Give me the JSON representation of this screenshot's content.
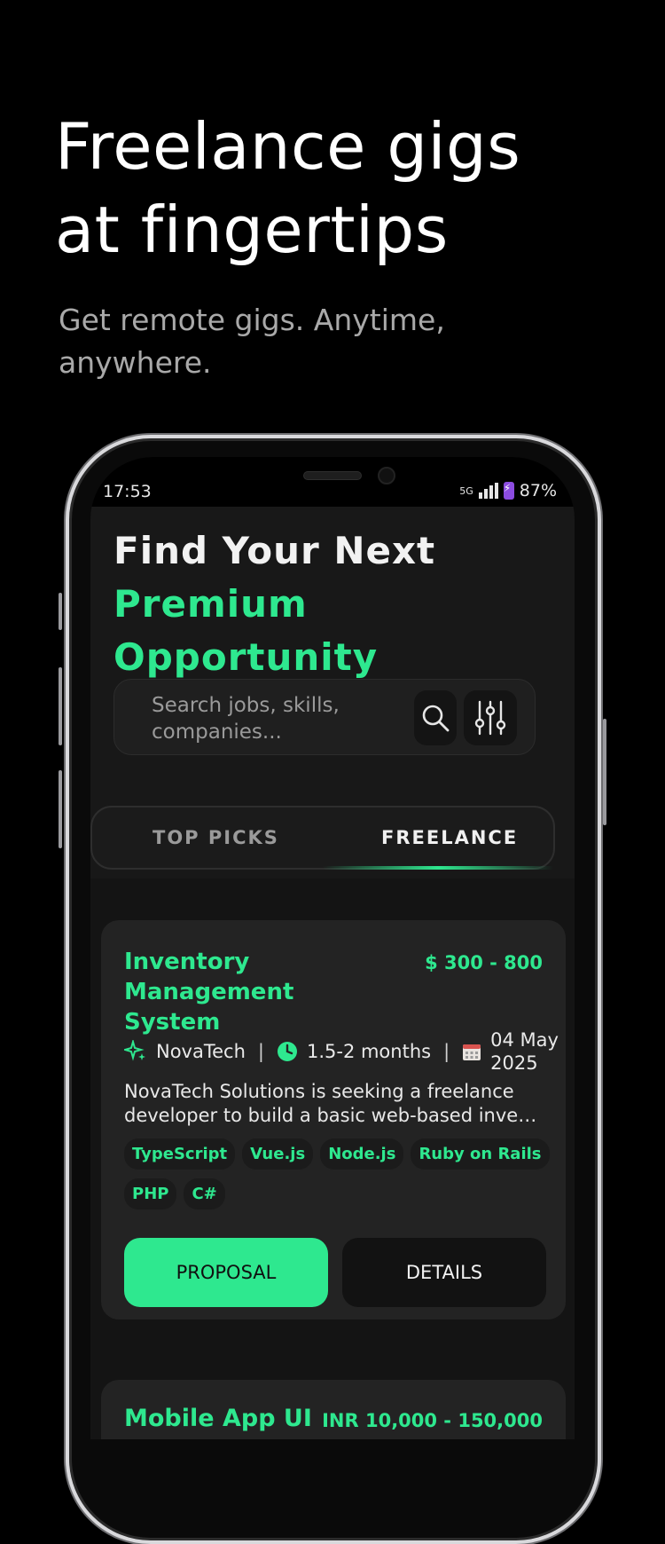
{
  "hero": {
    "title_line1": "Freelance gigs",
    "title_line2": "at fingertips",
    "subtitle_line1": "Get remote gigs. Anytime,",
    "subtitle_line2": "anywhere."
  },
  "status_bar": {
    "time": "17:53",
    "network": "5G",
    "battery": "87%"
  },
  "screen": {
    "heading_line1": "Find Your Next",
    "heading_line2": "Premium Opportunity",
    "search": {
      "placeholder_line1": "Search jobs, skills,",
      "placeholder_line2": "companies..."
    },
    "tabs": [
      {
        "label": "TOP PICKS",
        "active": false
      },
      {
        "label": "FREELANCE",
        "active": true
      }
    ],
    "jobs": [
      {
        "title_line1": "Inventory Management",
        "title_line2": "System",
        "pay": "$ 300 - 800",
        "company": "NovaTech",
        "duration": "1.5-2 months",
        "date_line1": "04 May",
        "date_line2": "2025",
        "description_line1": "NovaTech Solutions is seeking a freelance",
        "description_line2": "developer to build a basic web-based invento…",
        "skills": [
          "TypeScript",
          "Vue.js",
          "Node.js",
          "Ruby on Rails",
          "PHP",
          "C#"
        ],
        "proposal_label": "PROPOSAL",
        "details_label": "DETAILS"
      },
      {
        "title": "Mobile App UI",
        "pay": "INR 10,000 - 150,000"
      }
    ]
  },
  "colors": {
    "accent": "#2ee88f",
    "background": "#000000",
    "card": "#232323"
  }
}
